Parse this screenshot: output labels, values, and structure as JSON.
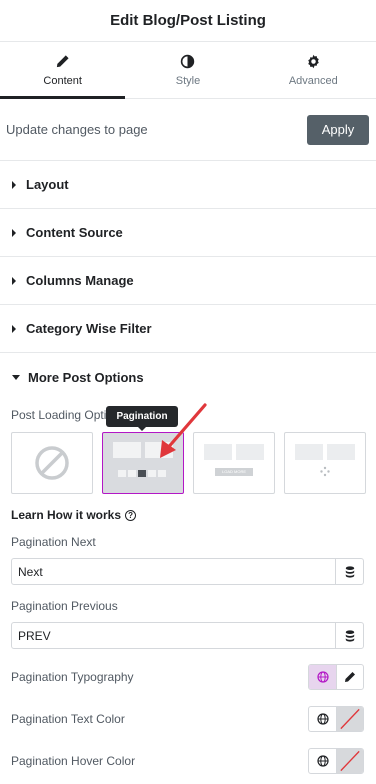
{
  "header": {
    "title": "Edit Blog/Post Listing"
  },
  "tabs": [
    {
      "label": "Content",
      "icon": "pencil-icon",
      "active": true
    },
    {
      "label": "Style",
      "icon": "contrast-icon",
      "active": false
    },
    {
      "label": "Advanced",
      "icon": "gear-icon",
      "active": false
    }
  ],
  "update": {
    "text": "Update changes to page",
    "apply_label": "Apply"
  },
  "sections": [
    {
      "label": "Layout"
    },
    {
      "label": "Content Source"
    },
    {
      "label": "Columns Manage"
    },
    {
      "label": "Category Wise Filter"
    },
    {
      "label": "More Post Options"
    }
  ],
  "more_post_options": {
    "loading_label": "Post Loading Opti",
    "tooltip": "Pagination",
    "options": [
      {
        "name": "none",
        "icon": "disabled-icon"
      },
      {
        "name": "pagination",
        "selected": true,
        "pages": [
          "1",
          "2",
          "3",
          "4",
          "5"
        ]
      },
      {
        "name": "load-more",
        "button_text": "LOAD MORE"
      },
      {
        "name": "lazy-load",
        "icon": "spinner-icon"
      }
    ],
    "learn_label": "Learn How it works",
    "learn_icon": "question-icon",
    "pagination_next": {
      "label": "Pagination Next",
      "value": "Next"
    },
    "pagination_previous": {
      "label": "Pagination Previous",
      "value": "PREV"
    },
    "typography": {
      "label": "Pagination Typography"
    },
    "text_color": {
      "label": "Pagination Text Color"
    },
    "hover_color": {
      "label": "Pagination Hover Color"
    }
  },
  "colors": {
    "accent": "#b317c6",
    "arrow": "#e0373b",
    "apply_bg": "#556068"
  }
}
